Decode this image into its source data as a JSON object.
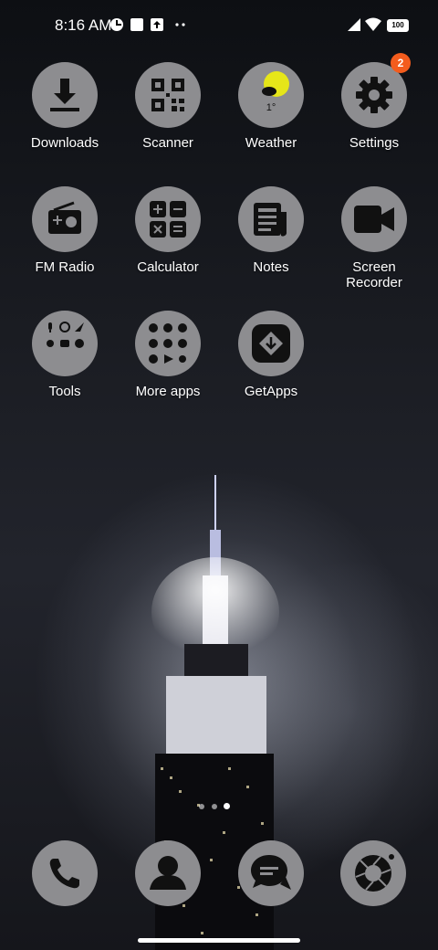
{
  "status_bar": {
    "time": "8:16 AM",
    "battery": "100"
  },
  "apps": [
    {
      "label": "Downloads",
      "icon": "download-icon"
    },
    {
      "label": "Scanner",
      "icon": "qr-code-icon"
    },
    {
      "label": "Weather",
      "icon": "weather-icon",
      "temperature": "1°"
    },
    {
      "label": "Settings",
      "icon": "gear-icon",
      "badge": "2"
    },
    {
      "label": "FM Radio",
      "icon": "radio-icon"
    },
    {
      "label": "Calculator",
      "icon": "calculator-icon"
    },
    {
      "label": "Notes",
      "icon": "notes-icon"
    },
    {
      "label": "Screen\nRecorder",
      "icon": "video-camera-icon"
    },
    {
      "label": "Tools",
      "icon": "folder-icon"
    },
    {
      "label": "More apps",
      "icon": "folder-icon"
    },
    {
      "label": "GetApps",
      "icon": "getapps-icon"
    }
  ],
  "dock": [
    "phone-icon",
    "contacts-icon",
    "messages-icon",
    "camera-icon"
  ],
  "page_indicator": {
    "pages": 3,
    "current": 2
  },
  "colors": {
    "icon_bg": "#8d8d90",
    "badge": "#f35c1d",
    "weather_sun": "#e6e619"
  }
}
